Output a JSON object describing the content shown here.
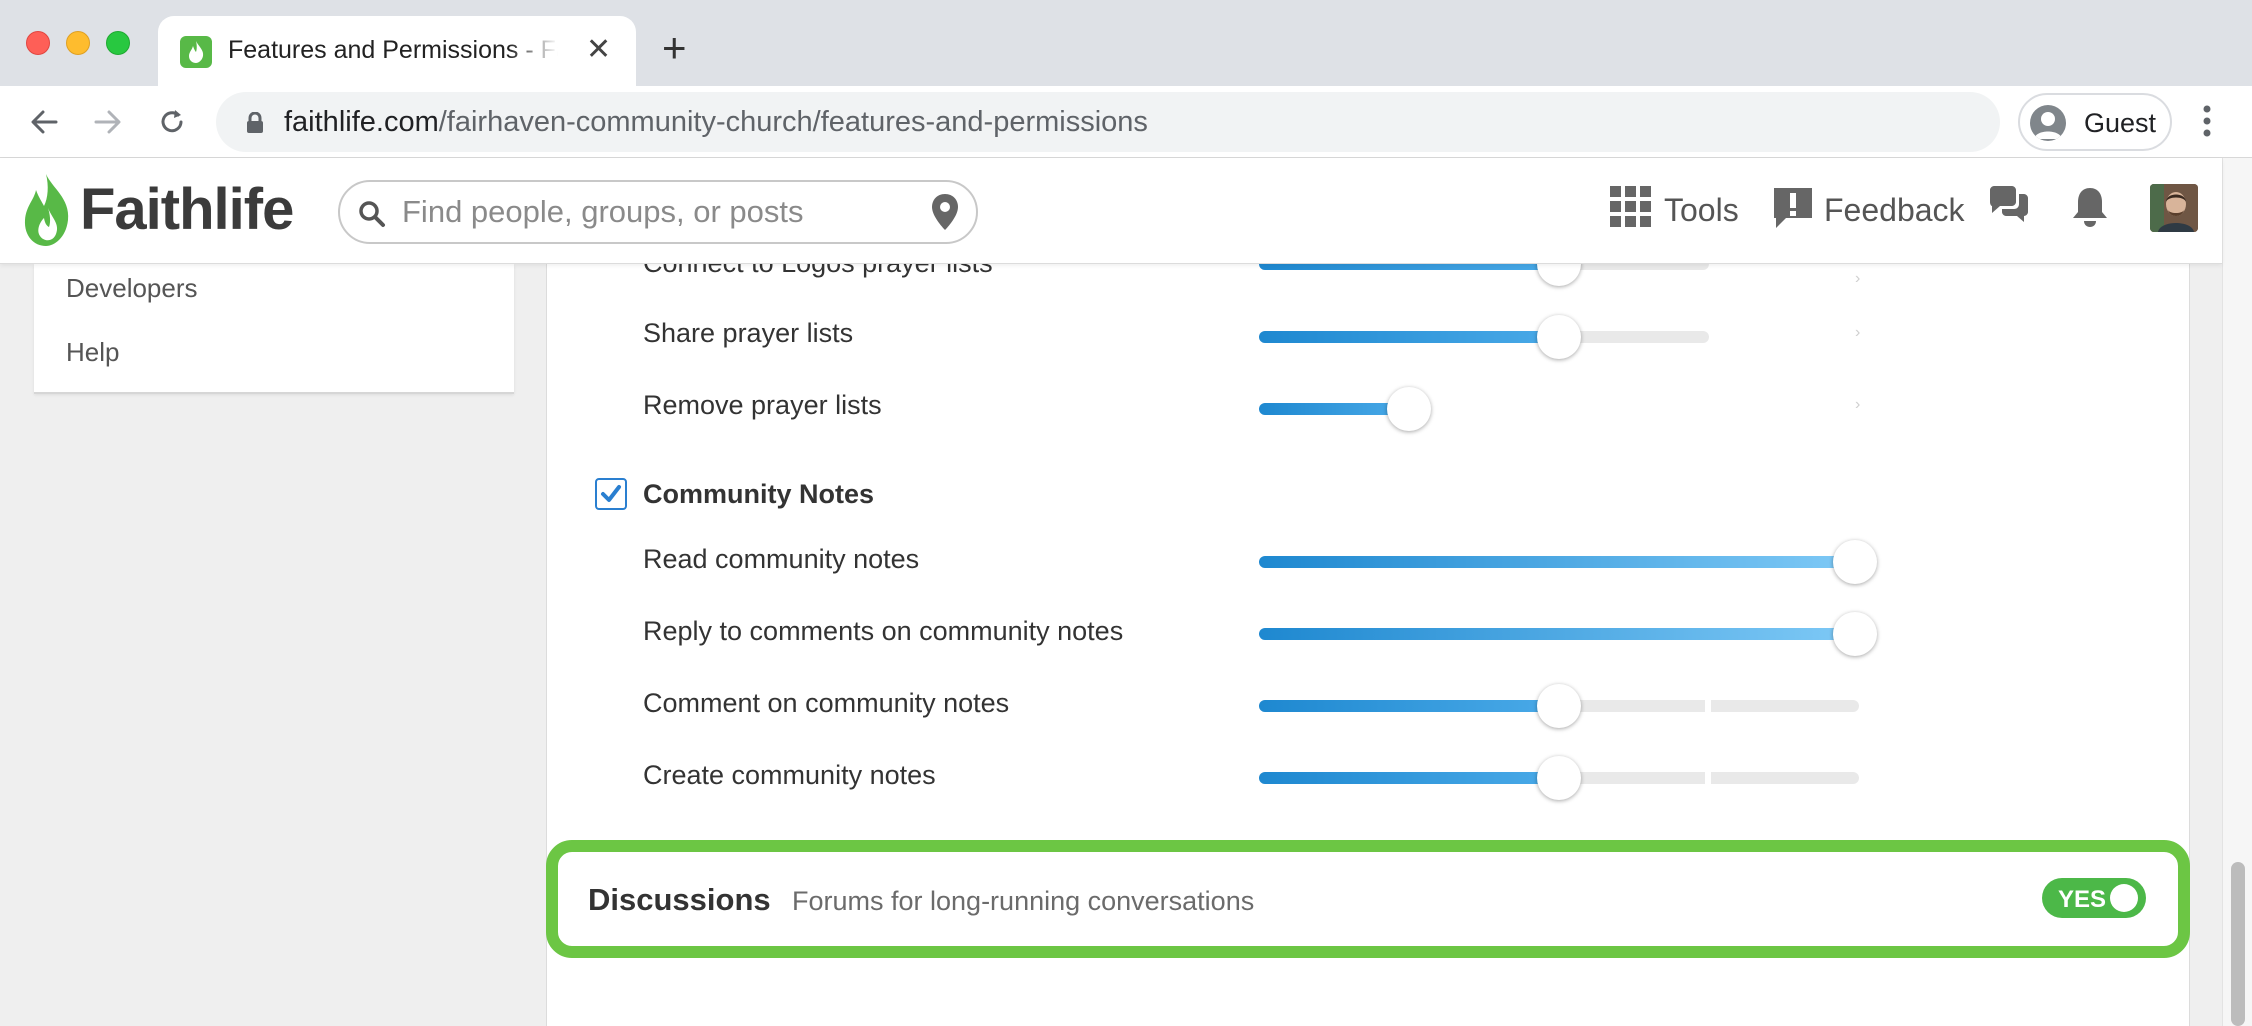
{
  "browser": {
    "tab_title": "Features and Permissions - Faithlife",
    "url_host": "faithlife.com",
    "url_path": "/fairhaven-community-church/features-and-permissions",
    "profile_label": "Guest"
  },
  "header": {
    "logo_text": "Faithlife",
    "search_placeholder": "Find people, groups, or posts",
    "tools_label": "Tools",
    "feedback_label": "Feedback"
  },
  "sidebar": {
    "items": [
      {
        "label": "Developers"
      },
      {
        "label": "Help"
      }
    ]
  },
  "permissions": {
    "prayer_rows": [
      {
        "label": "Connect to Logos prayer lists",
        "level": 0.5
      },
      {
        "label": "Share prayer lists",
        "level": 0.5
      },
      {
        "label": "Remove prayer lists",
        "level": 0.25
      }
    ],
    "community_notes": {
      "title": "Community Notes",
      "checked": true,
      "rows": [
        {
          "label": "Read community notes",
          "level": 1.0
        },
        {
          "label": "Reply to comments on community notes",
          "level": 1.0
        },
        {
          "label": "Comment on community notes",
          "level": 0.5
        },
        {
          "label": "Create community notes",
          "level": 0.5
        }
      ]
    }
  },
  "discussions": {
    "title": "Discussions",
    "description": "Forums for long-running conversations",
    "toggle_label": "YES",
    "enabled": true
  },
  "colors": {
    "accent_green": "#6cc644",
    "slider_blue": "#1e88d0",
    "toggle_green": "#4cb848"
  }
}
